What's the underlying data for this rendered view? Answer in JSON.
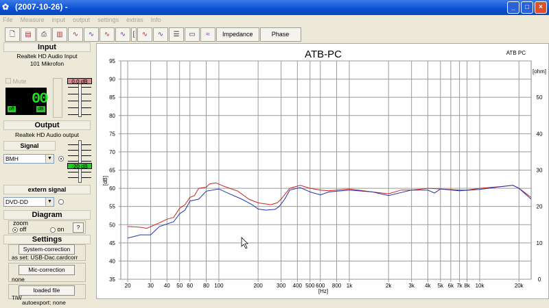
{
  "window": {
    "title": "(2007-10-26) -",
    "buttons": [
      "_",
      "□",
      "×"
    ]
  },
  "menu": [
    "File",
    "Measure",
    "input",
    "output",
    "settings",
    "extras",
    "Info"
  ],
  "toolbar": {
    "impedance": "Impedance",
    "phase": "Phase"
  },
  "input": {
    "header": "Input",
    "device": "Realtek HD Audio Input",
    "channel": "101 Mikrofon",
    "mute": "Mute",
    "level": "00",
    "off": "off",
    "db": "dB",
    "gain": "0.0 dB"
  },
  "output": {
    "header": "Output",
    "device": "Realtek HD Audio output",
    "signal_header": "Signal",
    "signal_value": "BMH",
    "level": "-20 dB",
    "extern_header": "extern signal",
    "extern_value": "DVD-DD"
  },
  "diagram": {
    "header": "Diagram",
    "zoom": "zoom",
    "off": "off",
    "on": "on",
    "help": "?"
  },
  "settings": {
    "header": "Settings",
    "system_correction": "System-correction",
    "system_value": "as set: USB-Dac.cardcorr",
    "mic_correction": "Mic-correction",
    "mic_value": "none",
    "loaded_file": "loaded file",
    "loaded_value": "TIW"
  },
  "status": "autoexport: none",
  "chart_data": {
    "type": "line",
    "title": "ATB-PC",
    "corner_label": "ATB PC",
    "xlabel": "[Hz]",
    "ylabel": "[dB]",
    "y2label": "[ohm]",
    "xscale": "log",
    "xlim": [
      17.7,
      24800
    ],
    "ylim": [
      35,
      95
    ],
    "y2lim": [
      0,
      60
    ],
    "xticks": [
      20,
      30,
      40,
      50,
      60,
      80,
      100,
      200,
      300,
      400,
      500,
      600,
      800,
      1000,
      2000,
      3000,
      4000,
      5000,
      6000,
      7000,
      8000,
      10000,
      20000
    ],
    "xtick_labels": [
      "20",
      "30",
      "40",
      "50",
      "60",
      "80",
      "100",
      "200",
      "300",
      "400",
      "500",
      "600",
      "800",
      "1k",
      "2k",
      "3k",
      "4k",
      "5k",
      "6k",
      "7k",
      "8k",
      "10k",
      "20k"
    ],
    "yticks": [
      35,
      40,
      45,
      50,
      55,
      60,
      65,
      70,
      75,
      80,
      85,
      90,
      95
    ],
    "y2ticks": [
      0,
      10,
      20,
      30,
      40,
      50
    ],
    "series": [
      {
        "name": "red",
        "color": "#cc2222",
        "points": [
          [
            20,
            49.5
          ],
          [
            25,
            49.3
          ],
          [
            28,
            49
          ],
          [
            35,
            50.5
          ],
          [
            40,
            51.5
          ],
          [
            45,
            52
          ],
          [
            50,
            54.5
          ],
          [
            55,
            55.5
          ],
          [
            60,
            57.5
          ],
          [
            65,
            58
          ],
          [
            70,
            60
          ],
          [
            80,
            60.3
          ],
          [
            85,
            61.2
          ],
          [
            95,
            61.5
          ],
          [
            110,
            60.5
          ],
          [
            140,
            59.2
          ],
          [
            170,
            57
          ],
          [
            200,
            56
          ],
          [
            250,
            55.5
          ],
          [
            280,
            56
          ],
          [
            300,
            57
          ],
          [
            350,
            60
          ],
          [
            420,
            60.8
          ],
          [
            500,
            60
          ],
          [
            600,
            59.5
          ],
          [
            700,
            59.3
          ],
          [
            1000,
            59.8
          ],
          [
            1500,
            59
          ],
          [
            2000,
            58.5
          ],
          [
            2500,
            59.5
          ],
          [
            3000,
            59.5
          ],
          [
            4000,
            60
          ],
          [
            5000,
            59.8
          ],
          [
            7000,
            59.5
          ],
          [
            8000,
            59.5
          ],
          [
            10000,
            60
          ],
          [
            15000,
            60.5
          ],
          [
            18000,
            60.8
          ],
          [
            20000,
            60
          ],
          [
            25000,
            57.5
          ]
        ]
      },
      {
        "name": "blue",
        "color": "#2233aa",
        "points": [
          [
            20,
            46.3
          ],
          [
            25,
            47.2
          ],
          [
            30,
            47.2
          ],
          [
            35,
            49.5
          ],
          [
            45,
            50.8
          ],
          [
            50,
            53
          ],
          [
            55,
            54
          ],
          [
            60,
            56.5
          ],
          [
            70,
            57
          ],
          [
            80,
            59.2
          ],
          [
            100,
            59.8
          ],
          [
            120,
            58.5
          ],
          [
            150,
            57
          ],
          [
            180,
            55.5
          ],
          [
            200,
            54.3
          ],
          [
            230,
            54
          ],
          [
            270,
            54.2
          ],
          [
            290,
            55
          ],
          [
            320,
            57
          ],
          [
            350,
            59.5
          ],
          [
            420,
            60.2
          ],
          [
            500,
            59
          ],
          [
            600,
            58.2
          ],
          [
            700,
            59
          ],
          [
            1000,
            59.5
          ],
          [
            1500,
            59
          ],
          [
            2000,
            58
          ],
          [
            3000,
            59.5
          ],
          [
            4000,
            59.5
          ],
          [
            4500,
            58.7
          ],
          [
            5000,
            59.8
          ],
          [
            7000,
            59.3
          ],
          [
            10000,
            59.7
          ],
          [
            15000,
            60.5
          ],
          [
            18000,
            60.8
          ],
          [
            20000,
            60
          ],
          [
            25000,
            57
          ]
        ]
      }
    ]
  }
}
